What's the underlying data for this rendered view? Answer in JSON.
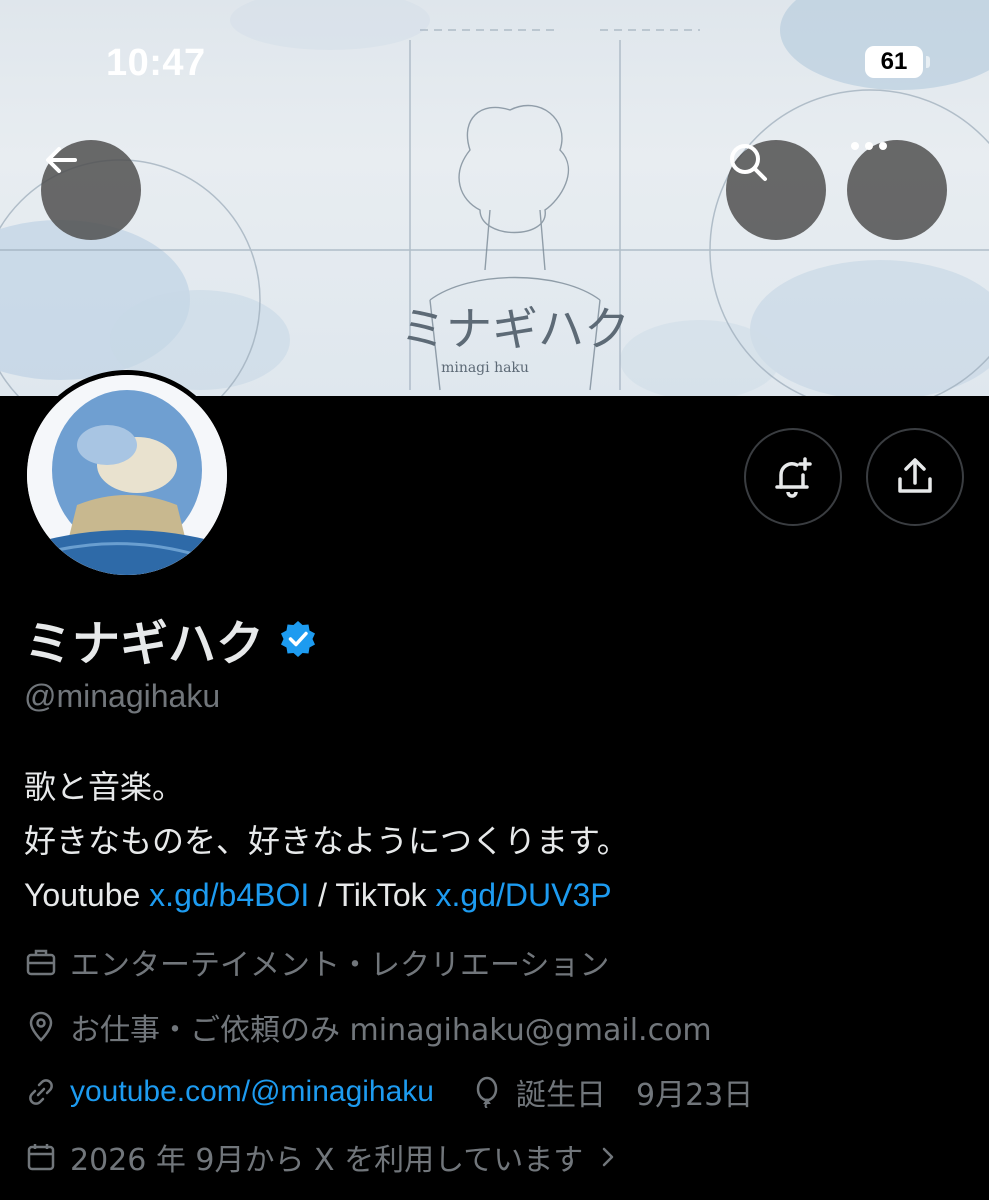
{
  "status_bar": {
    "time": "10:47",
    "battery": "61"
  },
  "banner": {
    "title": "ミナギハク",
    "subtitle": "minagi haku"
  },
  "profile": {
    "display_name": "ミナギハク",
    "handle": "@minagihaku",
    "bio": {
      "line1": "歌と音楽。",
      "line2": "好きなものを、好きなようにつくります。",
      "youtube_label": "Youtube ",
      "youtube_link": "x.gd/b4BOI",
      "separator": " / TikTok ",
      "tiktok_link": "x.gd/DUV3P"
    },
    "category": "エンターテイメント・レクリエーション",
    "location": "お仕事・ご依頼のみ minagihaku@gmail.com",
    "website": "youtube.com/@minagihaku",
    "birthday": "誕生日　9月23日",
    "joined": "2026 年 9月から X を利用しています"
  },
  "colors": {
    "link": "#1d9bf0",
    "verified": "#1d9bf0",
    "muted": "#71767b",
    "text": "#e7e9ea"
  },
  "icons": [
    "back-arrow-icon",
    "search-icon",
    "more-icon",
    "notification-bell-plus-icon",
    "share-icon",
    "verified-badge-icon",
    "briefcase-icon",
    "location-pin-icon",
    "link-icon",
    "balloon-icon",
    "calendar-icon",
    "chevron-right-icon"
  ]
}
